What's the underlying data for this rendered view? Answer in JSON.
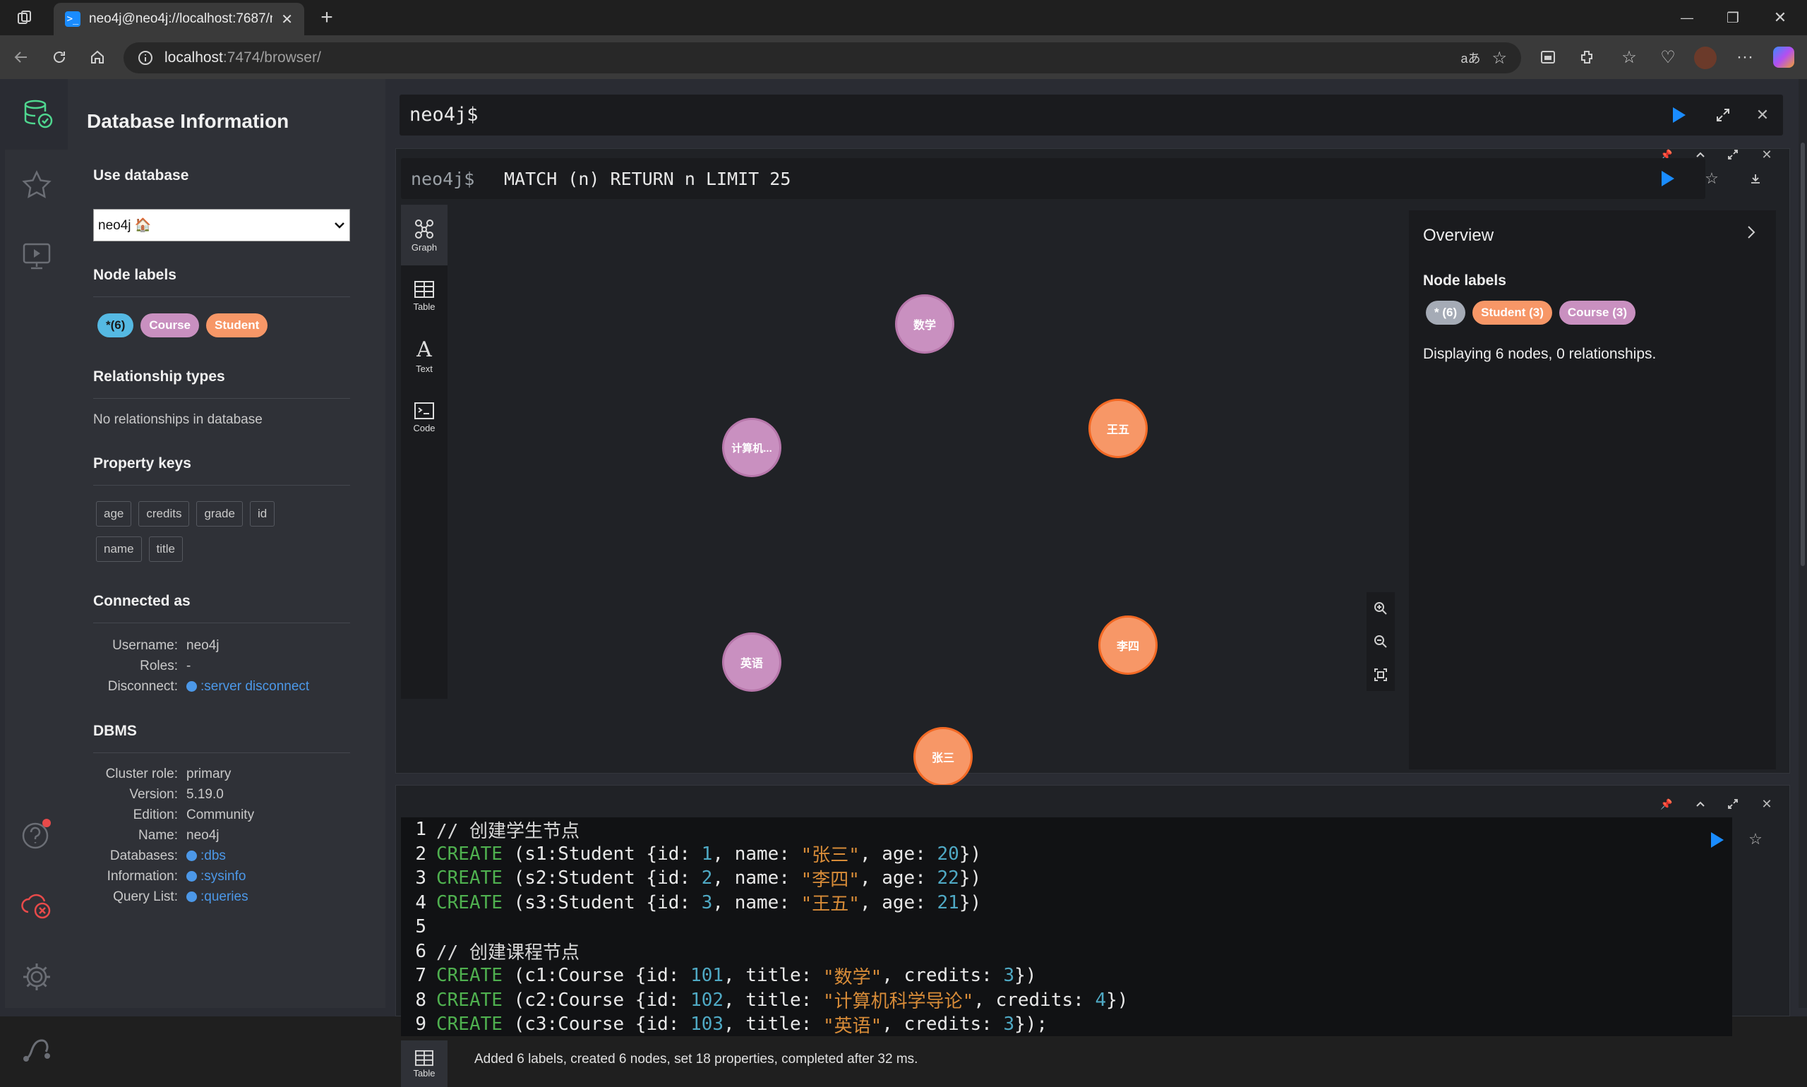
{
  "browser": {
    "tab_title": "neo4j@neo4j://localhost:7687/ne",
    "tab_close": "✕",
    "new_tab": "+",
    "url_host": "localhost",
    "url_rest": ":7474/browser/",
    "window_min": "—",
    "window_restore": "❐",
    "window_close": "✕"
  },
  "sidebar": {
    "title": "Database Information",
    "use_database": {
      "heading": "Use database",
      "selected": "neo4j 🏠"
    },
    "node_labels": {
      "heading": "Node labels",
      "pills": [
        {
          "label": "*(6)",
          "color": "#55b9e3",
          "text_color": "#1a1a1a"
        },
        {
          "label": "Course",
          "color": "#c990c0",
          "text_color": "#ffffff"
        },
        {
          "label": "Student",
          "color": "#f79767",
          "text_color": "#ffffff"
        }
      ]
    },
    "relationship_types": {
      "heading": "Relationship types",
      "text": "No relationships in database"
    },
    "property_keys": {
      "heading": "Property keys",
      "keys": [
        "age",
        "credits",
        "grade",
        "id",
        "name",
        "title"
      ]
    },
    "connected_as": {
      "heading": "Connected as",
      "rows": [
        {
          "k": "Username:",
          "v": "neo4j",
          "link": false
        },
        {
          "k": "Roles:",
          "v": "-",
          "link": false
        },
        {
          "k": "Disconnect:",
          "v": ":server disconnect",
          "link": true
        }
      ]
    },
    "dbms": {
      "heading": "DBMS",
      "rows": [
        {
          "k": "Cluster role:",
          "v": "primary",
          "link": false
        },
        {
          "k": "Version:",
          "v": "5.19.0",
          "link": false
        },
        {
          "k": "Edition:",
          "v": "Community",
          "link": false
        },
        {
          "k": "Name:",
          "v": "neo4j",
          "link": false
        },
        {
          "k": "Databases:",
          "v": ":dbs",
          "link": true
        },
        {
          "k": "Information:",
          "v": ":sysinfo",
          "link": true
        },
        {
          "k": "Query List:",
          "v": ":queries",
          "link": true
        }
      ]
    }
  },
  "editor": {
    "prompt": "neo4j$"
  },
  "frame1": {
    "prompt": "neo4j$",
    "query": "MATCH (n) RETURN n LIMIT 25",
    "view_tabs": [
      {
        "label": "Graph",
        "icon": "graph-icon"
      },
      {
        "label": "Table",
        "icon": "table-icon"
      },
      {
        "label": "Text",
        "icon": "text-icon"
      },
      {
        "label": "Code",
        "icon": "code-icon"
      }
    ],
    "nodes": [
      {
        "caption": "数学",
        "label": "Course"
      },
      {
        "caption": "王五",
        "label": "Student"
      },
      {
        "caption": "计算机...",
        "label": "Course"
      },
      {
        "caption": "英语",
        "label": "Course"
      },
      {
        "caption": "李四",
        "label": "Student"
      },
      {
        "caption": "张三",
        "label": "Student"
      }
    ],
    "overview": {
      "title": "Overview",
      "node_labels_heading": "Node labels",
      "pills": [
        {
          "label": "* (6)",
          "color": "#a5abb6",
          "text_color": "#ffffff"
        },
        {
          "label": "Student (3)",
          "color": "#f79767",
          "text_color": "#ffffff"
        },
        {
          "label": "Course (3)",
          "color": "#c990c0",
          "text_color": "#ffffff"
        }
      ],
      "summary": "Displaying 6 nodes, 0 relationships."
    }
  },
  "frame2": {
    "code_lines": [
      [
        [
          "c-com",
          "// 创建学生节点"
        ]
      ],
      [
        [
          "c-kw",
          "CREATE"
        ],
        [
          "c-punc",
          " ("
        ],
        [
          "c-id",
          "s1"
        ],
        [
          "c-punc",
          ":"
        ],
        [
          "c-id",
          "Student"
        ],
        [
          "c-punc",
          " {"
        ],
        [
          "c-id",
          "id"
        ],
        [
          "c-punc",
          ": "
        ],
        [
          "c-num",
          "1"
        ],
        [
          "c-punc",
          ", "
        ],
        [
          "c-id",
          "name"
        ],
        [
          "c-punc",
          ": "
        ],
        [
          "c-str",
          "\"张三\""
        ],
        [
          "c-punc",
          ", "
        ],
        [
          "c-id",
          "age"
        ],
        [
          "c-punc",
          ": "
        ],
        [
          "c-num",
          "20"
        ],
        [
          "c-punc",
          "})"
        ]
      ],
      [
        [
          "c-kw",
          "CREATE"
        ],
        [
          "c-punc",
          " ("
        ],
        [
          "c-id",
          "s2"
        ],
        [
          "c-punc",
          ":"
        ],
        [
          "c-id",
          "Student"
        ],
        [
          "c-punc",
          " {"
        ],
        [
          "c-id",
          "id"
        ],
        [
          "c-punc",
          ": "
        ],
        [
          "c-num",
          "2"
        ],
        [
          "c-punc",
          ", "
        ],
        [
          "c-id",
          "name"
        ],
        [
          "c-punc",
          ": "
        ],
        [
          "c-str",
          "\"李四\""
        ],
        [
          "c-punc",
          ", "
        ],
        [
          "c-id",
          "age"
        ],
        [
          "c-punc",
          ": "
        ],
        [
          "c-num",
          "22"
        ],
        [
          "c-punc",
          "})"
        ]
      ],
      [
        [
          "c-kw",
          "CREATE"
        ],
        [
          "c-punc",
          " ("
        ],
        [
          "c-id",
          "s3"
        ],
        [
          "c-punc",
          ":"
        ],
        [
          "c-id",
          "Student"
        ],
        [
          "c-punc",
          " {"
        ],
        [
          "c-id",
          "id"
        ],
        [
          "c-punc",
          ": "
        ],
        [
          "c-num",
          "3"
        ],
        [
          "c-punc",
          ", "
        ],
        [
          "c-id",
          "name"
        ],
        [
          "c-punc",
          ": "
        ],
        [
          "c-str",
          "\"王五\""
        ],
        [
          "c-punc",
          ", "
        ],
        [
          "c-id",
          "age"
        ],
        [
          "c-punc",
          ": "
        ],
        [
          "c-num",
          "21"
        ],
        [
          "c-punc",
          "})"
        ]
      ],
      [],
      [
        [
          "c-com",
          "// 创建课程节点"
        ]
      ],
      [
        [
          "c-kw",
          "CREATE"
        ],
        [
          "c-punc",
          " ("
        ],
        [
          "c-id",
          "c1"
        ],
        [
          "c-punc",
          ":"
        ],
        [
          "c-id",
          "Course"
        ],
        [
          "c-punc",
          " {"
        ],
        [
          "c-id",
          "id"
        ],
        [
          "c-punc",
          ": "
        ],
        [
          "c-num",
          "101"
        ],
        [
          "c-punc",
          ", "
        ],
        [
          "c-id",
          "title"
        ],
        [
          "c-punc",
          ": "
        ],
        [
          "c-str",
          "\"数学\""
        ],
        [
          "c-punc",
          ", "
        ],
        [
          "c-id",
          "credits"
        ],
        [
          "c-punc",
          ": "
        ],
        [
          "c-num",
          "3"
        ],
        [
          "c-punc",
          "})"
        ]
      ],
      [
        [
          "c-kw",
          "CREATE"
        ],
        [
          "c-punc",
          " ("
        ],
        [
          "c-id",
          "c2"
        ],
        [
          "c-punc",
          ":"
        ],
        [
          "c-id",
          "Course"
        ],
        [
          "c-punc",
          " {"
        ],
        [
          "c-id",
          "id"
        ],
        [
          "c-punc",
          ": "
        ],
        [
          "c-num",
          "102"
        ],
        [
          "c-punc",
          ", "
        ],
        [
          "c-id",
          "title"
        ],
        [
          "c-punc",
          ": "
        ],
        [
          "c-str",
          "\"计算机科学导论\""
        ],
        [
          "c-punc",
          ", "
        ],
        [
          "c-id",
          "credits"
        ],
        [
          "c-punc",
          ": "
        ],
        [
          "c-num",
          "4"
        ],
        [
          "c-punc",
          "})"
        ]
      ],
      [
        [
          "c-kw",
          "CREATE"
        ],
        [
          "c-punc",
          " ("
        ],
        [
          "c-id",
          "c3"
        ],
        [
          "c-punc",
          ":"
        ],
        [
          "c-id",
          "Course"
        ],
        [
          "c-punc",
          " {"
        ],
        [
          "c-id",
          "id"
        ],
        [
          "c-punc",
          ": "
        ],
        [
          "c-num",
          "103"
        ],
        [
          "c-punc",
          ", "
        ],
        [
          "c-id",
          "title"
        ],
        [
          "c-punc",
          ": "
        ],
        [
          "c-str",
          "\"英语\""
        ],
        [
          "c-punc",
          ", "
        ],
        [
          "c-id",
          "credits"
        ],
        [
          "c-punc",
          ": "
        ],
        [
          "c-num",
          "3"
        ],
        [
          "c-punc",
          "});"
        ]
      ]
    ],
    "result_tab_label": "Table",
    "result_text": "Added 6 labels, created 6 nodes, set 18 properties, completed after 32 ms."
  }
}
